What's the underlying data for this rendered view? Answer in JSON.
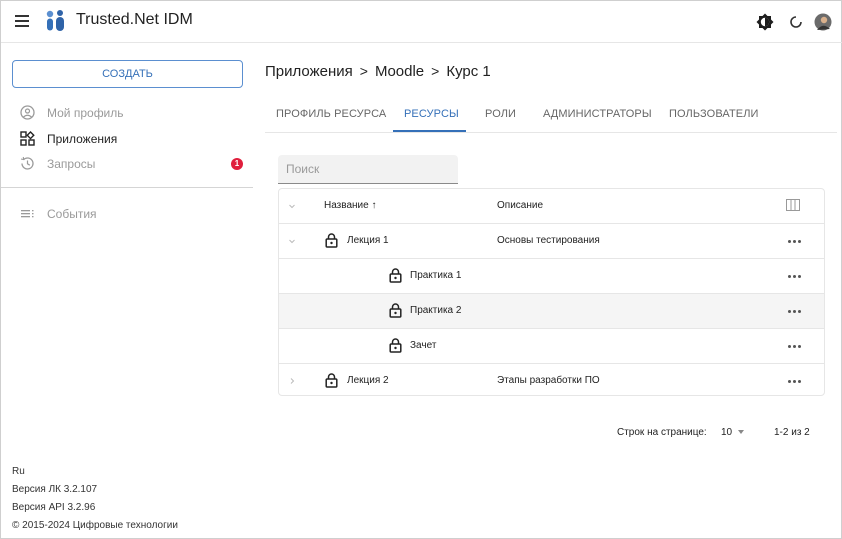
{
  "header": {
    "app_title": "Trusted.Net IDM",
    "icons": [
      "menu-icon",
      "brightness-icon",
      "refresh-icon",
      "user-avatar"
    ]
  },
  "sidebar": {
    "create_label": "СОЗДАТЬ",
    "items": [
      {
        "label": "Мой профиль",
        "icon": "account-circle-icon",
        "active": false
      },
      {
        "label": "Приложения",
        "icon": "apps-icon",
        "active": true
      },
      {
        "label": "Запросы",
        "icon": "history-icon",
        "active": false,
        "badge": "1"
      },
      {
        "label": "События",
        "icon": "events-list-icon",
        "active": false
      }
    ],
    "footer": {
      "lang": "Ru",
      "lk_version": "Версия ЛК 3.2.107",
      "api_version": "Версия API 3.2.96",
      "copyright": "© 2015-2024 Цифровые технологии"
    }
  },
  "breadcrumb": {
    "items": [
      "Приложения",
      "Moodle",
      "Курс 1"
    ],
    "separator": ">"
  },
  "tabs": [
    {
      "label": "ПРОФИЛЬ РЕСУРСА",
      "active": false
    },
    {
      "label": "РЕСУРСЫ",
      "active": true
    },
    {
      "label": "РОЛИ",
      "active": false
    },
    {
      "label": "АДМИНИСТРАТОРЫ",
      "active": false
    },
    {
      "label": "ПОЛЬЗОВАТЕЛИ",
      "active": false
    }
  ],
  "search": {
    "placeholder": "Поиск",
    "value": ""
  },
  "table": {
    "columns": {
      "name": "Название",
      "description": "Описание"
    },
    "sort_arrow": "↑",
    "rows": [
      {
        "name": "Лекция 1",
        "description": "Основы тестирования",
        "level": 0,
        "expanded": true
      },
      {
        "name": "Практика 1",
        "description": "",
        "level": 1
      },
      {
        "name": "Практика 2",
        "description": "",
        "level": 1,
        "highlighted": true
      },
      {
        "name": "Зачет",
        "description": "",
        "level": 1
      },
      {
        "name": "Лекция 2",
        "description": "Этапы разработки ПО",
        "level": 0,
        "expanded": false
      }
    ]
  },
  "pagination": {
    "rows_per_page_label": "Строк на странице:",
    "rows_per_page": "10",
    "range": "1-2 из 2"
  },
  "colors": {
    "accent": "#3570b8",
    "badge": "#e01e3c",
    "row_highlight": "#f5f5f5"
  }
}
